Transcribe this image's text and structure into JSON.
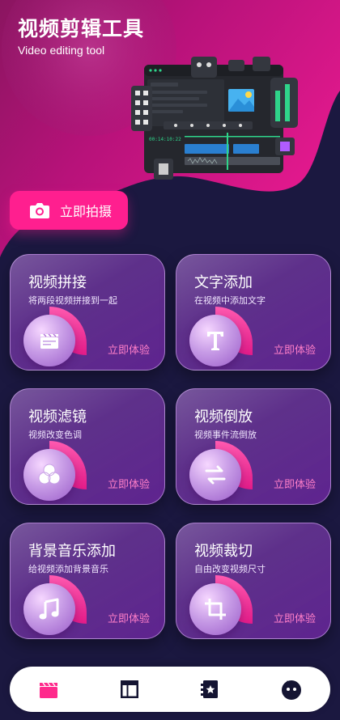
{
  "header": {
    "title": "视频剪辑工具",
    "subtitle": "Video editing tool"
  },
  "illustration": {
    "timecode": "00:14:10:22"
  },
  "shoot_button": {
    "label": "立即拍摄",
    "icon": "camera-icon"
  },
  "features": [
    {
      "title": "视频拼接",
      "desc": "将两段视频拼接到一起",
      "action": "立即体验",
      "icon": "clapperboard-icon"
    },
    {
      "title": "文字添加",
      "desc": "在视频中添加文字",
      "action": "立即体验",
      "icon": "text-t-icon"
    },
    {
      "title": "视频滤镜",
      "desc": "视频改变色调",
      "action": "立即体验",
      "icon": "filter-circles-icon"
    },
    {
      "title": "视频倒放",
      "desc": "视频事件流倒放",
      "action": "立即体验",
      "icon": "swap-arrows-icon"
    },
    {
      "title": "背景音乐添加",
      "desc": "给视频添加背景音乐",
      "action": "立即体验",
      "icon": "music-note-icon"
    },
    {
      "title": "视频裁切",
      "desc": "自由改变视频尺寸",
      "action": "立即体验",
      "icon": "crop-icon"
    }
  ],
  "nav": {
    "items": [
      "clapperboard-icon",
      "layout-icon",
      "bookmark-star-icon",
      "ghost-face-icon"
    ],
    "active_color": "#ff2a8c"
  },
  "colors": {
    "background": "#1b1840",
    "accent": "#ff1f8f",
    "action_text": "#ff7fc8"
  }
}
